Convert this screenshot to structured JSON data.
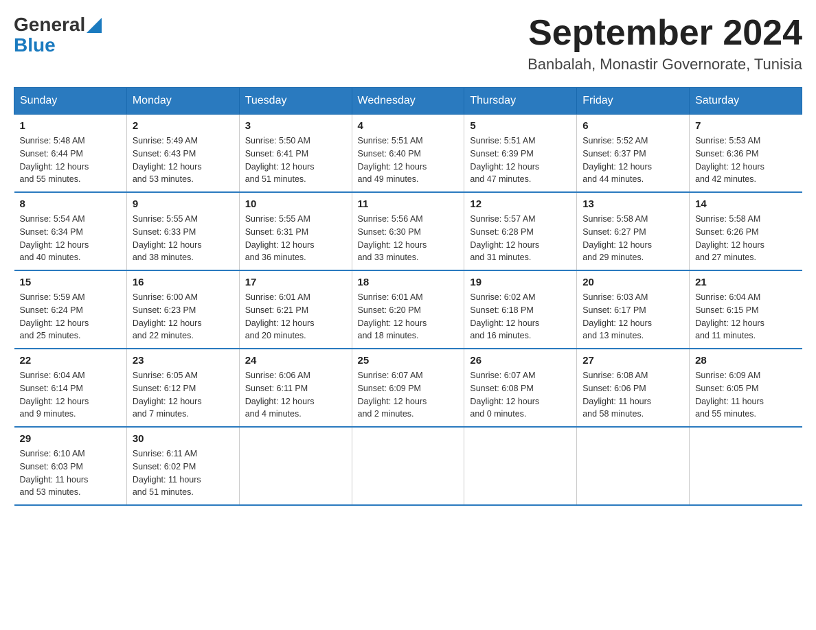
{
  "header": {
    "logo_general": "General",
    "logo_blue": "Blue",
    "month_title": "September 2024",
    "location": "Banbalah, Monastir Governorate, Tunisia"
  },
  "days_of_week": [
    "Sunday",
    "Monday",
    "Tuesday",
    "Wednesday",
    "Thursday",
    "Friday",
    "Saturday"
  ],
  "weeks": [
    [
      {
        "day": "1",
        "sunrise": "5:48 AM",
        "sunset": "6:44 PM",
        "daylight": "12 hours and 55 minutes."
      },
      {
        "day": "2",
        "sunrise": "5:49 AM",
        "sunset": "6:43 PM",
        "daylight": "12 hours and 53 minutes."
      },
      {
        "day": "3",
        "sunrise": "5:50 AM",
        "sunset": "6:41 PM",
        "daylight": "12 hours and 51 minutes."
      },
      {
        "day": "4",
        "sunrise": "5:51 AM",
        "sunset": "6:40 PM",
        "daylight": "12 hours and 49 minutes."
      },
      {
        "day": "5",
        "sunrise": "5:51 AM",
        "sunset": "6:39 PM",
        "daylight": "12 hours and 47 minutes."
      },
      {
        "day": "6",
        "sunrise": "5:52 AM",
        "sunset": "6:37 PM",
        "daylight": "12 hours and 44 minutes."
      },
      {
        "day": "7",
        "sunrise": "5:53 AM",
        "sunset": "6:36 PM",
        "daylight": "12 hours and 42 minutes."
      }
    ],
    [
      {
        "day": "8",
        "sunrise": "5:54 AM",
        "sunset": "6:34 PM",
        "daylight": "12 hours and 40 minutes."
      },
      {
        "day": "9",
        "sunrise": "5:55 AM",
        "sunset": "6:33 PM",
        "daylight": "12 hours and 38 minutes."
      },
      {
        "day": "10",
        "sunrise": "5:55 AM",
        "sunset": "6:31 PM",
        "daylight": "12 hours and 36 minutes."
      },
      {
        "day": "11",
        "sunrise": "5:56 AM",
        "sunset": "6:30 PM",
        "daylight": "12 hours and 33 minutes."
      },
      {
        "day": "12",
        "sunrise": "5:57 AM",
        "sunset": "6:28 PM",
        "daylight": "12 hours and 31 minutes."
      },
      {
        "day": "13",
        "sunrise": "5:58 AM",
        "sunset": "6:27 PM",
        "daylight": "12 hours and 29 minutes."
      },
      {
        "day": "14",
        "sunrise": "5:58 AM",
        "sunset": "6:26 PM",
        "daylight": "12 hours and 27 minutes."
      }
    ],
    [
      {
        "day": "15",
        "sunrise": "5:59 AM",
        "sunset": "6:24 PM",
        "daylight": "12 hours and 25 minutes."
      },
      {
        "day": "16",
        "sunrise": "6:00 AM",
        "sunset": "6:23 PM",
        "daylight": "12 hours and 22 minutes."
      },
      {
        "day": "17",
        "sunrise": "6:01 AM",
        "sunset": "6:21 PM",
        "daylight": "12 hours and 20 minutes."
      },
      {
        "day": "18",
        "sunrise": "6:01 AM",
        "sunset": "6:20 PM",
        "daylight": "12 hours and 18 minutes."
      },
      {
        "day": "19",
        "sunrise": "6:02 AM",
        "sunset": "6:18 PM",
        "daylight": "12 hours and 16 minutes."
      },
      {
        "day": "20",
        "sunrise": "6:03 AM",
        "sunset": "6:17 PM",
        "daylight": "12 hours and 13 minutes."
      },
      {
        "day": "21",
        "sunrise": "6:04 AM",
        "sunset": "6:15 PM",
        "daylight": "12 hours and 11 minutes."
      }
    ],
    [
      {
        "day": "22",
        "sunrise": "6:04 AM",
        "sunset": "6:14 PM",
        "daylight": "12 hours and 9 minutes."
      },
      {
        "day": "23",
        "sunrise": "6:05 AM",
        "sunset": "6:12 PM",
        "daylight": "12 hours and 7 minutes."
      },
      {
        "day": "24",
        "sunrise": "6:06 AM",
        "sunset": "6:11 PM",
        "daylight": "12 hours and 4 minutes."
      },
      {
        "day": "25",
        "sunrise": "6:07 AM",
        "sunset": "6:09 PM",
        "daylight": "12 hours and 2 minutes."
      },
      {
        "day": "26",
        "sunrise": "6:07 AM",
        "sunset": "6:08 PM",
        "daylight": "12 hours and 0 minutes."
      },
      {
        "day": "27",
        "sunrise": "6:08 AM",
        "sunset": "6:06 PM",
        "daylight": "11 hours and 58 minutes."
      },
      {
        "day": "28",
        "sunrise": "6:09 AM",
        "sunset": "6:05 PM",
        "daylight": "11 hours and 55 minutes."
      }
    ],
    [
      {
        "day": "29",
        "sunrise": "6:10 AM",
        "sunset": "6:03 PM",
        "daylight": "11 hours and 53 minutes."
      },
      {
        "day": "30",
        "sunrise": "6:11 AM",
        "sunset": "6:02 PM",
        "daylight": "11 hours and 51 minutes."
      },
      null,
      null,
      null,
      null,
      null
    ]
  ],
  "labels": {
    "sunrise": "Sunrise:",
    "sunset": "Sunset:",
    "daylight": "Daylight:"
  }
}
